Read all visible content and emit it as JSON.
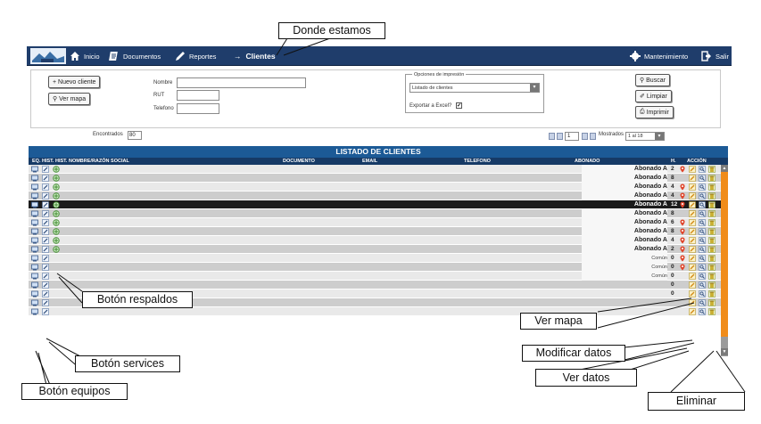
{
  "nav": {
    "items": [
      "Inicio",
      "Documentos",
      "Reportes"
    ],
    "current": "Clientes",
    "current_arrow": "→",
    "right": [
      "Mantenimiento",
      "Salir"
    ]
  },
  "panel": {
    "nuevo_cliente": "+ Nuevo cliente",
    "ver_mapa": "Ver mapa",
    "nombre_label": "Nombre",
    "rut_label": "RUT",
    "telefono_label": "Telefono",
    "opciones_legend": "Opciones de impresión",
    "print_select": "Listado de clientes",
    "exportar_label": "Exportar a Excel?",
    "exportar_checked": "✔",
    "buscar": "Buscar",
    "limpiar": "Limpiar",
    "imprimir": "Imprimir"
  },
  "pager": {
    "encontrados_label": "Encontrados",
    "encontrados_value": "80",
    "page": "1",
    "mostrados_label": "Mostrados",
    "mostrados_value": "1 al 18"
  },
  "table": {
    "title": "LISTADO DE CLIENTES",
    "columns": [
      "EQ. HIST.",
      "HIST. NOMBRE/RAZÓN SOCIAL",
      "DOCUMENTO",
      "EMAIL",
      "TELEFONO",
      "ABONADO",
      "H.",
      "ACCIÓN"
    ],
    "rows": [
      {
        "abonado": "Abonado A",
        "h": "2",
        "mapa": true,
        "backup": true
      },
      {
        "abonado": "Abonado A",
        "h": "8",
        "mapa": false,
        "backup": true
      },
      {
        "abonado": "Abonado A",
        "h": "4",
        "mapa": true,
        "backup": true
      },
      {
        "abonado": "Abonado A",
        "h": "4",
        "mapa": true,
        "backup": true
      },
      {
        "abonado": "Abonado A",
        "h": "12",
        "mapa": true,
        "backup": true,
        "selected": true
      },
      {
        "abonado": "Abonado A",
        "h": "8",
        "mapa": false,
        "backup": true
      },
      {
        "abonado": "Abonado A",
        "h": "6",
        "mapa": true,
        "backup": true
      },
      {
        "abonado": "Abonado A",
        "h": "8",
        "mapa": true,
        "backup": true
      },
      {
        "abonado": "Abonado A",
        "h": "4",
        "mapa": true,
        "backup": true
      },
      {
        "abonado": "Abonado A",
        "h": "2",
        "mapa": true,
        "backup": true
      },
      {
        "abonado": "Común",
        "h": "0",
        "mapa": true,
        "backup": false
      },
      {
        "abonado": "Común",
        "h": "0",
        "mapa": true,
        "backup": false
      },
      {
        "abonado": "Común",
        "h": "0",
        "mapa": false,
        "backup": false
      },
      {
        "abonado": "",
        "h": "0",
        "mapa": false,
        "backup": false
      },
      {
        "abonado": "",
        "h": "0",
        "mapa": false,
        "backup": false
      },
      {
        "abonado": "",
        "h": "",
        "mapa": false,
        "backup": false
      },
      {
        "abonado": "",
        "h": "",
        "mapa": false,
        "backup": false
      }
    ]
  },
  "callouts": {
    "donde_estamos": "Donde estamos",
    "boton_respaldos": "Botón respaldos",
    "ver_mapa": "Ver mapa",
    "boton_services": "Botón services",
    "modificar_datos": "Modificar datos",
    "boton_equipos": "Botón equipos",
    "ver_datos": "Ver datos",
    "eliminar": "Eliminar"
  },
  "colors": {
    "nav_bg": "#1f3d6b",
    "table_header": "#1c5a96",
    "scroll_accent": "#f08c1a",
    "selected_row": "#1b1b1b"
  }
}
